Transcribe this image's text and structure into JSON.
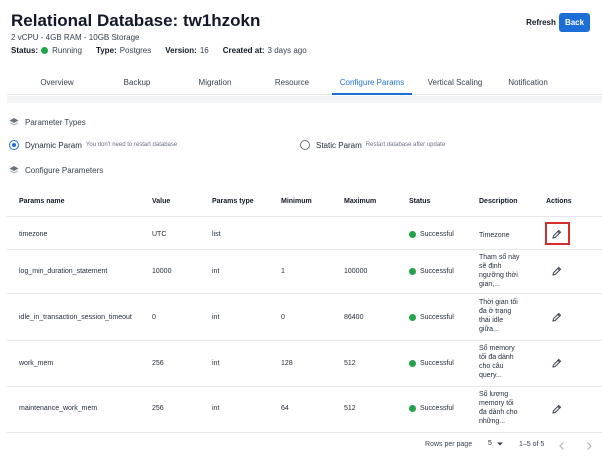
{
  "header": {
    "title": "Relational Database: tw1hzokn",
    "spec": "2 vCPU - 4GB RAM - 10GB Storage",
    "status_label": "Status:",
    "status_value": "Running",
    "type_label": "Type:",
    "type_value": "Postgres",
    "version_label": "Version:",
    "version_value": "16",
    "created_label": "Created at:",
    "created_value": "3 days ago",
    "refresh_label": "Refresh",
    "back_label": "Back"
  },
  "tabs": [
    "Overview",
    "Backup",
    "Migration",
    "Resource",
    "Configure Params",
    "Vertical Scaling",
    "Notification"
  ],
  "active_tab": "Configure Params",
  "param_types": {
    "title": "Parameter Types",
    "dynamic_label": "Dynamic Param",
    "dynamic_hint": "You don't need to restart database",
    "static_label": "Static Param",
    "static_hint": "Restart database after update",
    "selected": "dynamic"
  },
  "configure": {
    "title": "Configure Parameters"
  },
  "table": {
    "columns": [
      "Params name",
      "Value",
      "Params type",
      "Minimum",
      "Maximum",
      "Status",
      "Description",
      "Actions"
    ],
    "rows": [
      {
        "name": "timezone",
        "value": "UTC",
        "type": "list",
        "min": "",
        "max": "",
        "status": "Successful",
        "desc": [
          "Timezone"
        ]
      },
      {
        "name": "log_min_duration_statement",
        "value": "10000",
        "type": "int",
        "min": "1",
        "max": "100000",
        "status": "Successful",
        "desc": [
          "Tham số này",
          "sẽ định",
          "ngưỡng thời",
          "gian,..."
        ]
      },
      {
        "name": "idle_in_transaction_session_timeout",
        "value": "0",
        "type": "int",
        "min": "0",
        "max": "86400",
        "status": "Successful",
        "desc": [
          "Thời gian tối",
          "đa ở trạng",
          "thái idle",
          "giữa..."
        ]
      },
      {
        "name": "work_mem",
        "value": "256",
        "type": "int",
        "min": "128",
        "max": "512",
        "status": "Successful",
        "desc": [
          "Số memory",
          "tối đa dành",
          "cho câu",
          "query..."
        ]
      },
      {
        "name": "maintenance_work_mem",
        "value": "256",
        "type": "int",
        "min": "64",
        "max": "512",
        "status": "Successful",
        "desc": [
          "Số lượng",
          "memory tối",
          "đa dành cho",
          "những..."
        ]
      }
    ]
  },
  "pagination": {
    "rows_per_page_label": "Rows per page",
    "rows_per_page_value": "5",
    "range_text": "1–5 of 5"
  },
  "colors": {
    "accent": "#1d6fd8",
    "success": "#22a34a",
    "highlight": "#d32f2f"
  }
}
